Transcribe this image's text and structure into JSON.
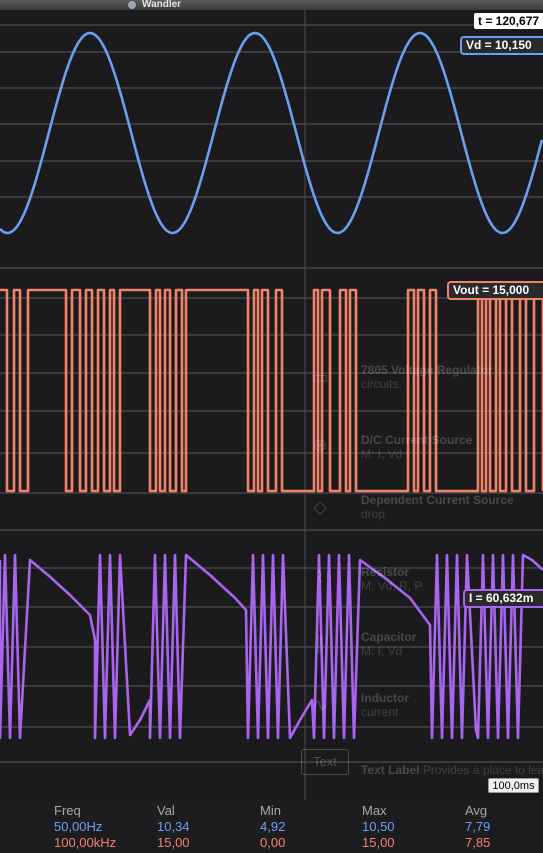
{
  "window": {
    "title": "Wandler"
  },
  "time_readout": "t = 120,677",
  "readouts": {
    "vd": "Vd = 10,150",
    "vout": "Vout = 15,000",
    "i": "I = 60,632m"
  },
  "timebase": "100,0ms",
  "stats": {
    "headers": [
      "Freq",
      "Val",
      "Min",
      "Max",
      "Avg"
    ],
    "rows": [
      [
        "50,00Hz",
        "10,34",
        "4,92",
        "10,50",
        "7,79"
      ],
      [
        "100,00kHz",
        "15,00",
        "0,00",
        "15,00",
        "7,85"
      ]
    ]
  },
  "background_panel": {
    "items": [
      {
        "title": "7805 Voltage Regulator",
        "sub": "circuits."
      },
      {
        "title": "D/C Current Source",
        "sub": "M: I, Vd"
      },
      {
        "title": "Dependent Current Source",
        "sub": "drop"
      },
      {
        "title": "Resistor",
        "sub": "M: Vd, R, P"
      },
      {
        "title": "Capacitor",
        "sub": "M: I, Vd"
      },
      {
        "title": "Inductor",
        "sub": "current"
      },
      {
        "title": "Text Label",
        "sub": "Provides a place to leave"
      }
    ],
    "text_button": "Text"
  },
  "colors": {
    "vd": "#6aa0f0",
    "vout": "#f2836a",
    "i": "#a965ee",
    "grid": "#6f6f73",
    "background": "#1b1b1d"
  },
  "chart_data": {
    "type": "line",
    "title": "",
    "xlabel": "",
    "ylabel": "",
    "grid": true,
    "series": [
      {
        "name": "Vd",
        "shape": "sine",
        "frequency_hz": 50,
        "min": 4.92,
        "max": 10.5,
        "avg": 7.79,
        "value_at_cursor": 10.15
      },
      {
        "name": "Vout",
        "shape": "pwm",
        "frequency_hz": 100000,
        "min": 0.0,
        "max": 15.0,
        "avg": 7.85,
        "value_at_cursor": 15.0
      },
      {
        "name": "I",
        "shape": "sawtooth-pwm",
        "unit": "m",
        "value_at_cursor": 60.632
      }
    ],
    "cursor_time": 120.677,
    "timebase": "100,0ms"
  }
}
